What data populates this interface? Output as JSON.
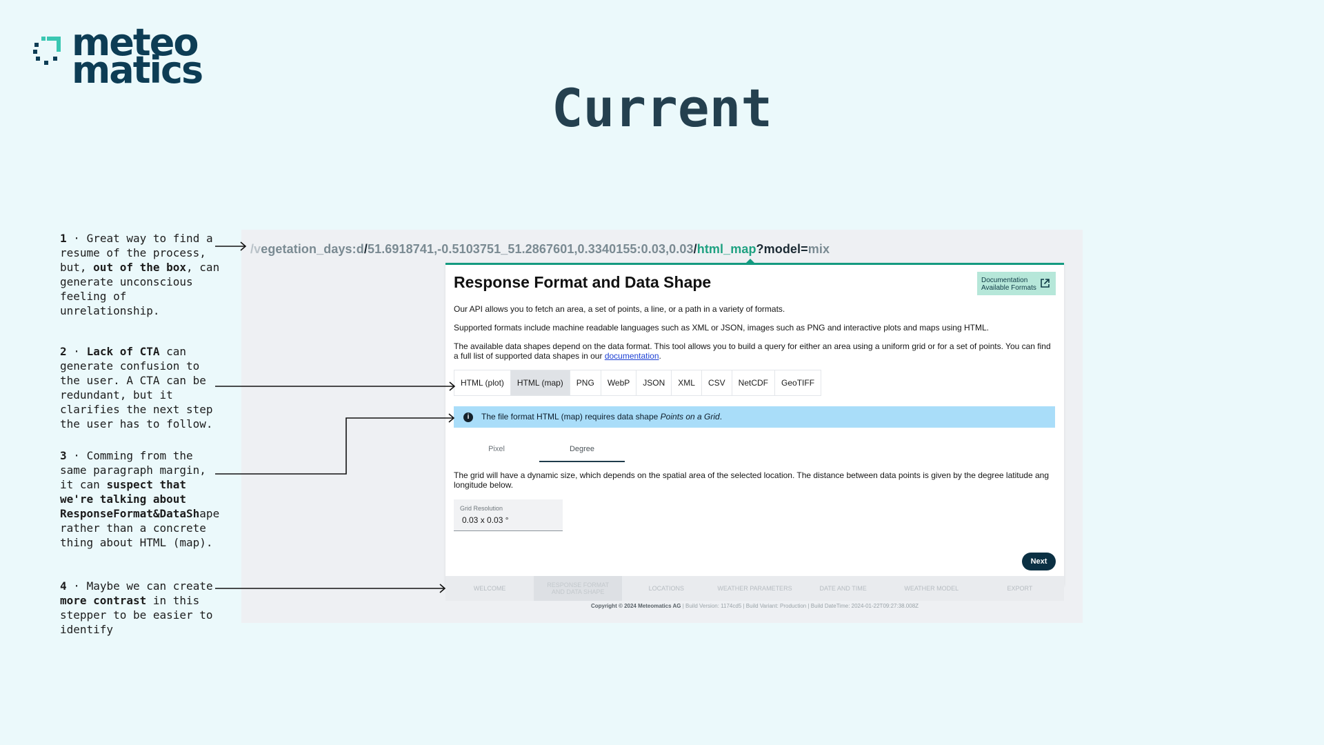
{
  "logo": {
    "line1": "meteo",
    "line2": "matics"
  },
  "slide": {
    "title": "Current"
  },
  "notes": [
    {
      "num": "1",
      "sep": "·",
      "t1": "Great way to find a resume of the process, but, ",
      "b1": "out of the box",
      "t2": ", can generate unconscious feeling of unrelationship.",
      "b2": "",
      "t3": ""
    },
    {
      "num": "2",
      "sep": "·",
      "t1": "",
      "b1": "Lack of CTA",
      "t2": " can generate confusion to the user. A CTA can be redundant, but it clarifies the next step the user has to follow.",
      "b2": "",
      "t3": ""
    },
    {
      "num": "3",
      "sep": "·",
      "t1": "Comming from the same paragraph margin, it can ",
      "b1": "suspect that we're talking about ResponseFormat&DataSh",
      "t2": "ape rather than a concrete thing about HTML (map).",
      "b2": "",
      "t3": ""
    },
    {
      "num": "4",
      "sep": "·",
      "t1": "Maybe we can create ",
      "b1": "more contrast",
      "t2": " in this stepper to be easier to identify",
      "b2": "",
      "t3": ""
    }
  ],
  "url": {
    "p1": "/v",
    "p2": "egetation_days:d",
    "p3": "/",
    "p4": "51.6918741,-0.5103751_51.2867601,0.3340155:0.03,0.03",
    "p5": "/",
    "p6": "html_map",
    "p7": "?model=",
    "p8": "mix"
  },
  "card": {
    "title": "Response Format and Data Shape",
    "doc_button": {
      "line1": "Documentation",
      "line2": "Available Formats",
      "icon": "external-link-icon"
    },
    "para1": "Our API allows you to fetch an area, a set of points, a line, or a path in a variety of formats.",
    "para2": "Supported formats include machine readable languages such as XML or JSON, images such as PNG and interactive plots and maps using HTML.",
    "para3": "The available data shapes depend on the data format. This tool allows you to build a query for either an area using a uniform grid or for a set of points. You can find a full list of supported data shapes in our ",
    "para3_link": "documentation",
    "para3_end": ".",
    "formats": [
      "HTML (plot)",
      "HTML (map)",
      "PNG",
      "WebP",
      "JSON",
      "XML",
      "CSV",
      "NetCDF",
      "GeoTIFF"
    ],
    "active_format": "HTML (map)",
    "info": {
      "icon": "info-icon",
      "text": "The file format HTML (map) requires data shape ",
      "shape": "Points on a Grid",
      "end": "."
    },
    "shape_tabs": [
      "Pixel",
      "Degree"
    ],
    "active_shape": "Degree",
    "grid_text": "The grid will have a dynamic size, which depends on the spatial area of the selected location. The distance between data points is given by the degree latitude ang longitude below.",
    "grid_label": "Grid Resolution",
    "grid_value": "0.03 x 0.03 °",
    "next": "Next"
  },
  "stepper": [
    "WELCOME",
    "RESPONSE FORMAT AND DATA SHAPE",
    "LOCATIONS",
    "WEATHER PARAMETERS",
    "DATE AND TIME",
    "WEATHER MODEL",
    "EXPORT"
  ],
  "active_step": 1,
  "footer": {
    "copy": "Copyright © 2024 Meteomatics AG",
    "version": "| Build Version: 1174cd5",
    "variant": "| Build Variant: Production",
    "datetime": "| Build DateTime: 2024-01-22T09:27:38.008Z"
  },
  "colors": {
    "background": "#ebf9fb",
    "brand_dark": "#0d3d55",
    "brand_teal": "#3ac7b2",
    "accent_green": "#139a80",
    "info_blue": "#a9ddf9"
  }
}
